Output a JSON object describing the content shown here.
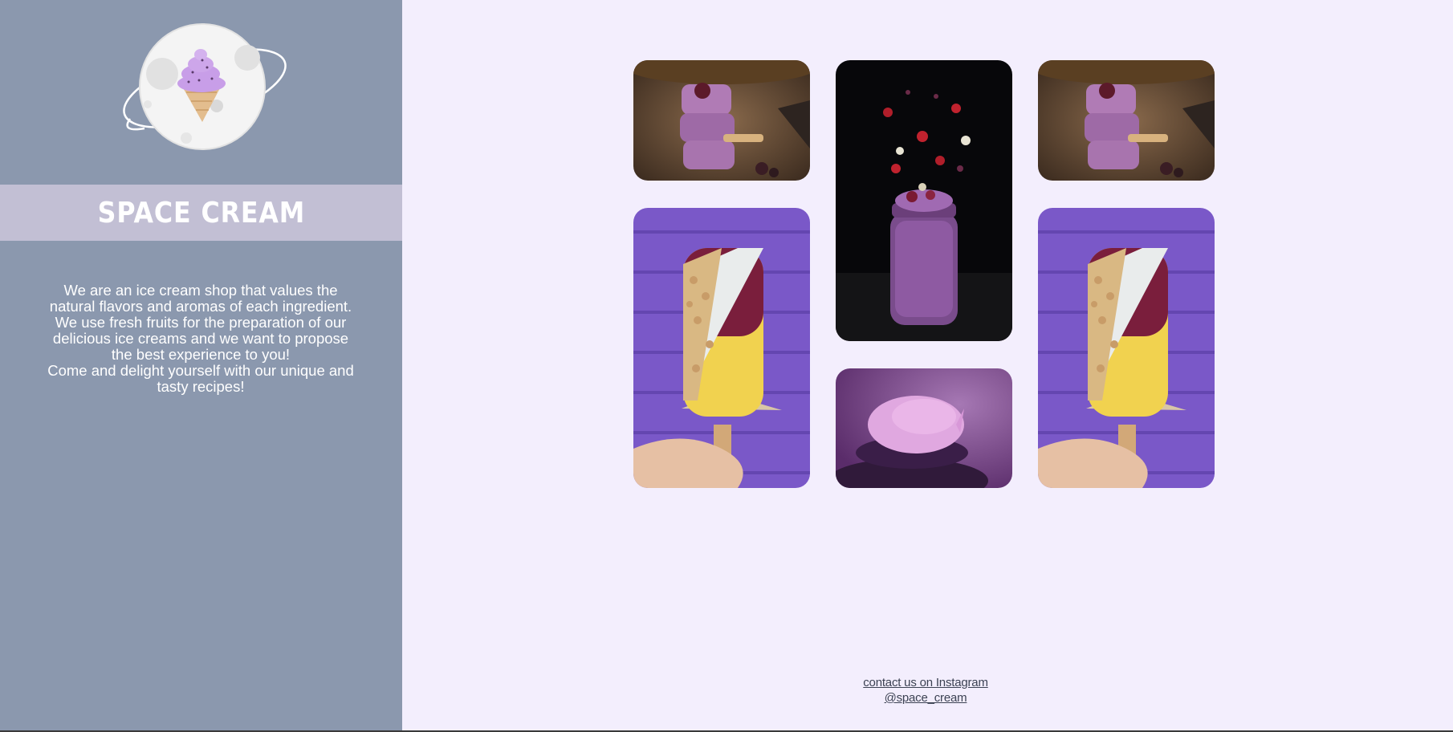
{
  "sidebar": {
    "brand_title": "SPACE CREAM",
    "about_lines": [
      "We are an ice cream shop that values the",
      "natural flavors and aromas of each ingredient.",
      "We use fresh fruits for the preparation of our",
      "delicious ice creams and we want to propose",
      "the best experience to you!",
      "Come and delight yourself with our unique and",
      "tasty recipes!"
    ]
  },
  "gallery": {
    "photos": [
      {
        "subject": "stacked purple popsicles with blackberry"
      },
      {
        "subject": "purple smoothie jar with falling fruits"
      },
      {
        "subject": "stacked purple popsicles with blackberry"
      },
      {
        "subject": "popsicle with nuts over purple brick wall"
      },
      {
        "subject": "scoop of purple ice cream"
      },
      {
        "subject": "popsicle with nuts over purple brick wall"
      }
    ]
  },
  "footer": {
    "contact_link": "contact us on Instagram @space_cream"
  },
  "colors": {
    "sidebar_bg": "#8b98ae",
    "title_band_bg": "#c2bfd4",
    "page_bg": "#f3eefd"
  }
}
